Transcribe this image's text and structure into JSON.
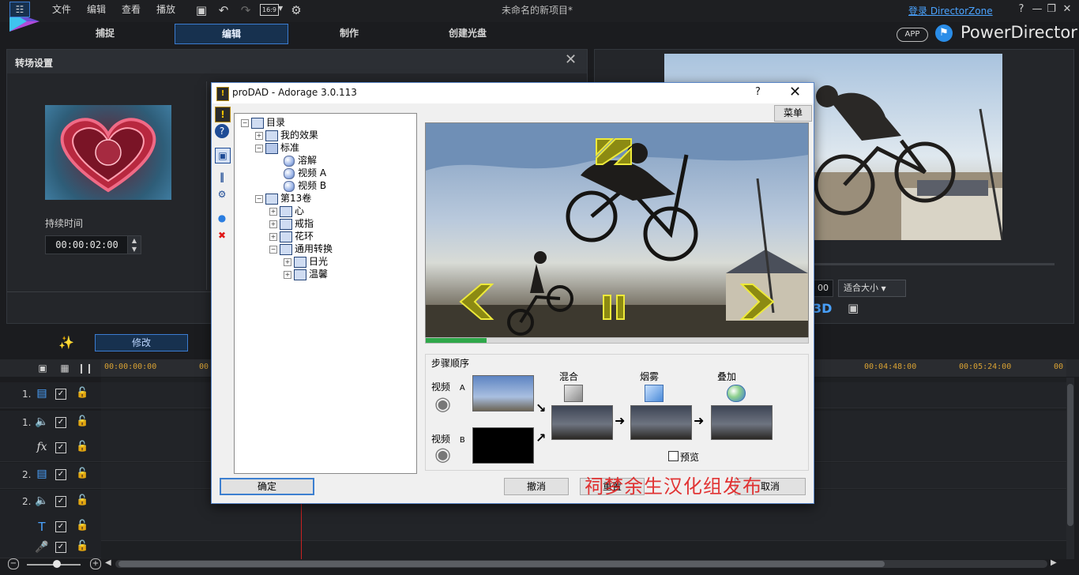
{
  "app": {
    "project_title": "未命名的新项目*",
    "brand": "PowerDirector",
    "app_badge": "APP",
    "login_link": "登录 DirectorZone",
    "aspect_ratio": "16:9"
  },
  "menu": [
    "文件",
    "编辑",
    "查看",
    "播放"
  ],
  "mode_tabs": [
    "捕捉",
    "编辑",
    "制作",
    "创建光盘"
  ],
  "transition_panel": {
    "title": "转场设置",
    "duration_label": "持续时间",
    "duration_value": "00:00:02:00"
  },
  "preview_panel": {
    "time_partial": "00",
    "fit_option": "适合大小"
  },
  "toolbar": {
    "modify_label": "修改"
  },
  "timeline": {
    "ruler_labels": [
      "00:00:00:00",
      "00",
      "00:04:48:00",
      "00:05:24:00",
      "00"
    ],
    "tracks": [
      {
        "num": "1.",
        "type": "video"
      },
      {
        "num": "1.",
        "type": "audio"
      },
      {
        "num": "",
        "type": "fx",
        "label": "fx"
      },
      {
        "num": "2.",
        "type": "video"
      },
      {
        "num": "2.",
        "type": "audio"
      },
      {
        "num": "",
        "type": "title",
        "label": "T"
      },
      {
        "num": "",
        "type": "voice"
      }
    ]
  },
  "dialog": {
    "title": "proDAD - Adorage 3.0.113",
    "help": "?",
    "menu_button": "菜单",
    "tree": {
      "root": "目录",
      "my_effects": "我的效果",
      "standard": "标准",
      "standard_items": [
        "溶解",
        "视频 A",
        "视频 B"
      ],
      "volume": "第13卷",
      "volume_items": [
        "心",
        "戒指",
        "花环",
        "通用转换"
      ],
      "general_items": [
        "日光",
        "温馨"
      ]
    },
    "steps": {
      "label": "步骤顺序",
      "video_a": "视频",
      "video_a_letter": "A",
      "video_b": "视频",
      "video_b_letter": "B",
      "mix": "混合",
      "fog": "烟雾",
      "overlay": "叠加",
      "preview_label": "预览"
    },
    "progress": 0.16,
    "buttons": {
      "ok": "确定",
      "cancel": "撤消",
      "reset": "重置",
      "close": "取消"
    },
    "watermark": "祠梦余生汉化组发布"
  },
  "colors": {
    "accent": "#3b7cd1",
    "brand_blue": "#2a8de8",
    "link": "#4aa3ff",
    "ruler_time": "#d9a233",
    "playhead": "#c92222",
    "watermark": "#e02020",
    "progress": "#2fa84a"
  }
}
